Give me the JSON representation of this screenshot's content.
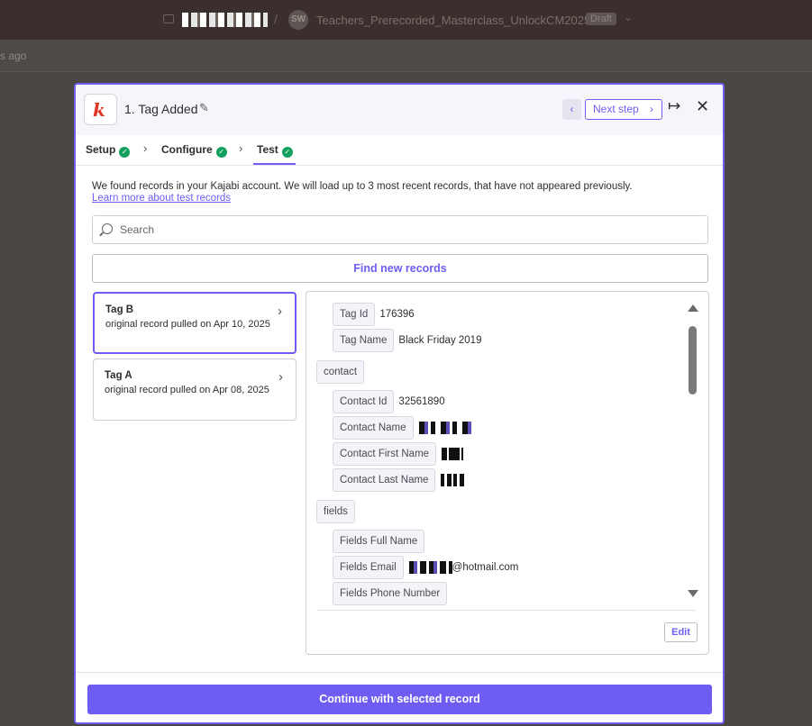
{
  "topbar": {
    "folder_name_redacted": "",
    "separator": "/",
    "avatar_initials": "SW",
    "zap_name": "Teachers_Prerecorded_Masterclass_UnlockCM2025",
    "status_badge": "Draft",
    "dropdown_glyph": "⌄"
  },
  "subbar": {
    "time_ago": "s ago"
  },
  "modal": {
    "app_logo": "k",
    "step_title": "1. Tag Added",
    "pencil_glyph": "✎",
    "prev_glyph": "‹",
    "next_step_label": "Next step",
    "next_glyph": "›",
    "collapse_glyph": "↦",
    "close_glyph": "✕",
    "tabs": [
      {
        "label": "Setup",
        "complete": true
      },
      {
        "label": "Configure",
        "complete": true
      },
      {
        "label": "Test",
        "complete": true,
        "active": true
      }
    ],
    "tab_chevron": "›",
    "check_glyph": "✓",
    "info_text": "We found records in your Kajabi account. We will load up to 3 most recent records, that have not appeared previously.",
    "learn_more": "Learn more about test records",
    "search_placeholder": "Search",
    "find_new_records": "Find new records",
    "records": [
      {
        "title": "Tag B",
        "subtitle": "original record pulled on Apr 10, 2025",
        "selected": true
      },
      {
        "title": "Tag A",
        "subtitle": "original record pulled on Apr 08, 2025",
        "selected": false
      }
    ],
    "record_chevron": "›",
    "fields": {
      "tag_id_key": "Tag Id",
      "tag_id_val": "176396",
      "tag_name_key": "Tag Name",
      "tag_name_val": "Black Friday 2019",
      "contact_group": "contact",
      "contact_id_key": "Contact Id",
      "contact_id_val": "32561890",
      "contact_name_key": "Contact Name",
      "contact_first_key": "Contact First Name",
      "contact_last_key": "Contact Last Name",
      "fields_group": "fields",
      "full_name_key": "Fields Full Name",
      "email_key": "Fields Email",
      "email_suffix": "@hotmail.com",
      "phone_key": "Fields Phone Number"
    },
    "edit_label": "Edit",
    "continue_label": "Continue with selected record"
  },
  "colors": {
    "accent": "#6d5df2",
    "success": "#13a05f",
    "kajabi_red": "#e03525",
    "backdrop": "#4a4644"
  }
}
